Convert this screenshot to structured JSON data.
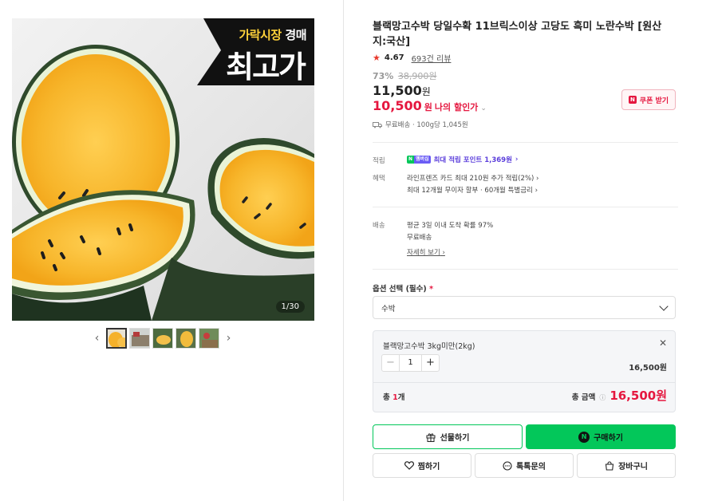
{
  "gallery": {
    "badge_top_a": "가락시장",
    "badge_top_b": "경매",
    "badge_main": "최고가",
    "counter": "1/30",
    "thumb_count": 5
  },
  "product": {
    "title": "블랙망고수박 당일수확 11브릭스이상 고당도 흑미 노란수박 [원산지:국산]",
    "rating": "4.67",
    "reviews": "693건 리뷰",
    "discount_rate": "73%",
    "original_price": "38,900원",
    "price_value": "11,500",
    "price_unit": "원",
    "my_price_value": "10,500",
    "my_price_unit": "원",
    "my_price_label": "나의 할인가",
    "coupon_label": "쿠폰 받기",
    "coupon_n": "N",
    "shipping": "무료배송 · 100g당 1,045원"
  },
  "benefits": {
    "points_label": "적립",
    "npay_a": "N",
    "npay_b": "멤버십",
    "points_text": "최대 적립 포인트 1,369원",
    "benefit_label": "혜택",
    "benefit_line1": "라인프렌즈 카드 최대 210원 추가 적립(2%)",
    "benefit_line2": "최대 12개월 무이자 할부 · 60개월 특별금리",
    "delivery_label": "배송",
    "delivery_line1": "평균 3일 이내 도착 확률 97%",
    "delivery_line2": "무료배송",
    "more_link": "자세히 보기"
  },
  "option": {
    "label": "옵션 선택 (필수)",
    "required_mark": "*",
    "selected_value": "수박"
  },
  "selected_item": {
    "name": "블랙망고수박 3kg미만(2kg)",
    "quantity": "1",
    "price": "16,500원",
    "total_count_prefix": "총 ",
    "total_count_num": "1",
    "total_count_suffix": "개",
    "total_label": "총 금액",
    "total_price": "16,500원"
  },
  "actions": {
    "gift": "선물하기",
    "buy": "구매하기",
    "wish": "찜하기",
    "talk": "톡톡문의",
    "cart": "장바구니"
  },
  "colors": {
    "brand_green": "#03c75a",
    "sale_red": "#e5173f",
    "points_purple": "#5a3ddb"
  }
}
